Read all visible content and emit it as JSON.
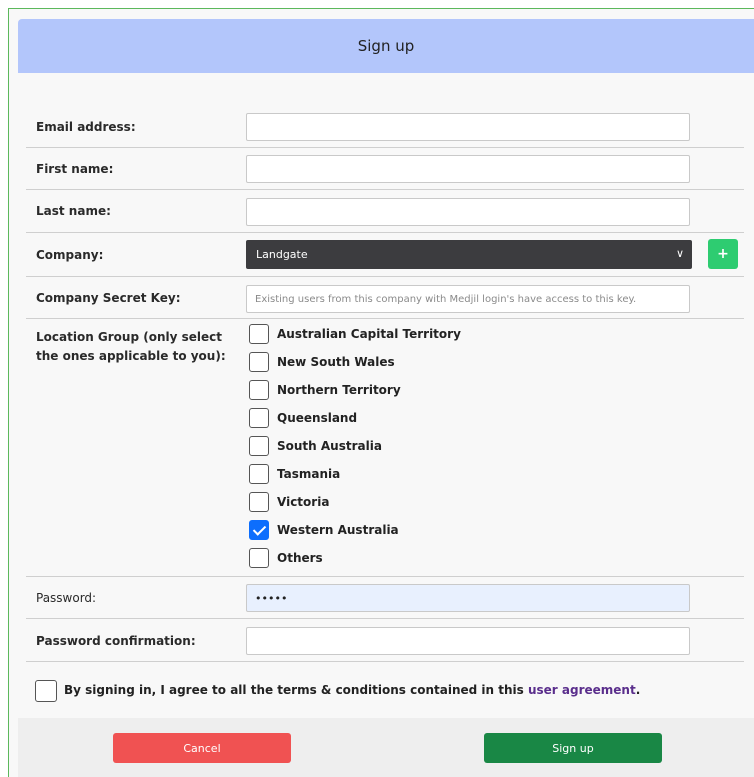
{
  "header": {
    "title": "Sign up"
  },
  "fields": {
    "email": {
      "label": "Email address:",
      "value": ""
    },
    "first_name": {
      "label": "First name:",
      "value": ""
    },
    "last_name": {
      "label": "Last name:",
      "value": ""
    },
    "company": {
      "label": "Company:",
      "selected": "Landgate",
      "add_label": "+"
    },
    "secret_key": {
      "label": "Company Secret Key:",
      "placeholder": "Existing users from this company with Medjil login's have access to this key."
    },
    "location_group": {
      "label": "Location Group (only select the ones applicable to you):",
      "options": [
        {
          "label": "Australian Capital Territory",
          "checked": false
        },
        {
          "label": "New South Wales",
          "checked": false
        },
        {
          "label": "Northern Territory",
          "checked": false
        },
        {
          "label": "Queensland",
          "checked": false
        },
        {
          "label": "South Australia",
          "checked": false
        },
        {
          "label": "Tasmania",
          "checked": false
        },
        {
          "label": "Victoria",
          "checked": false
        },
        {
          "label": "Western Australia",
          "checked": true
        },
        {
          "label": "Others",
          "checked": false
        }
      ]
    },
    "password": {
      "label": "Password:",
      "value": "•••••"
    },
    "password_confirm": {
      "label": "Password confirmation:",
      "value": ""
    }
  },
  "agreement": {
    "text": "By signing in, I agree to all the terms & conditions contained in this ",
    "link": "user agreement",
    "suffix": ".",
    "checked": false
  },
  "buttons": {
    "cancel": "Cancel",
    "signup": "Sign up"
  }
}
